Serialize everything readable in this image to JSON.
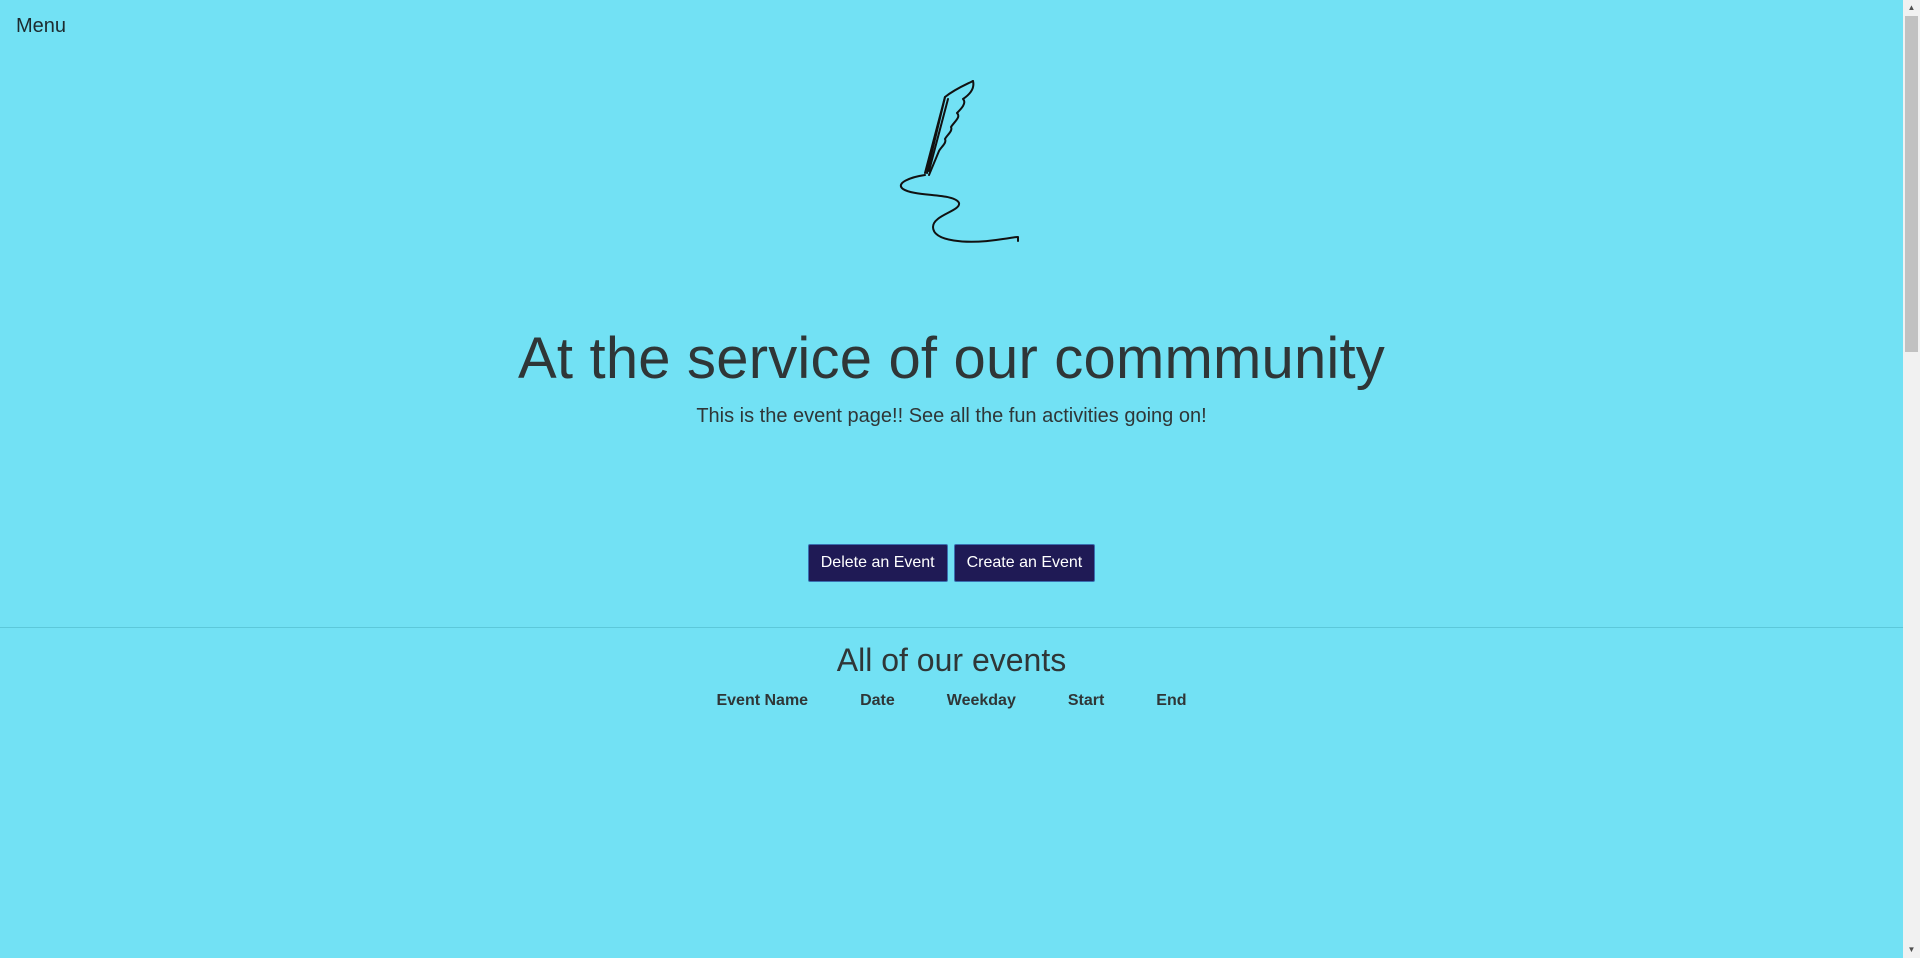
{
  "nav": {
    "menu_label": "Menu"
  },
  "logo": {
    "icon": "quill-pen-icon"
  },
  "hero": {
    "title": "At the service of our commmunity",
    "subtitle": "This is the event page!! See all the fun activities going on!"
  },
  "actions": {
    "delete_label": "Delete an Event",
    "create_label": "Create an Event"
  },
  "events": {
    "title": "All of our events",
    "columns": [
      "Event Name",
      "Date",
      "Weekday",
      "Start",
      "End"
    ],
    "rows": []
  },
  "colors": {
    "background": "#72e1f4",
    "button_bg": "#1f1a55",
    "button_border": "#3a6fb0",
    "text": "#2f3637"
  }
}
